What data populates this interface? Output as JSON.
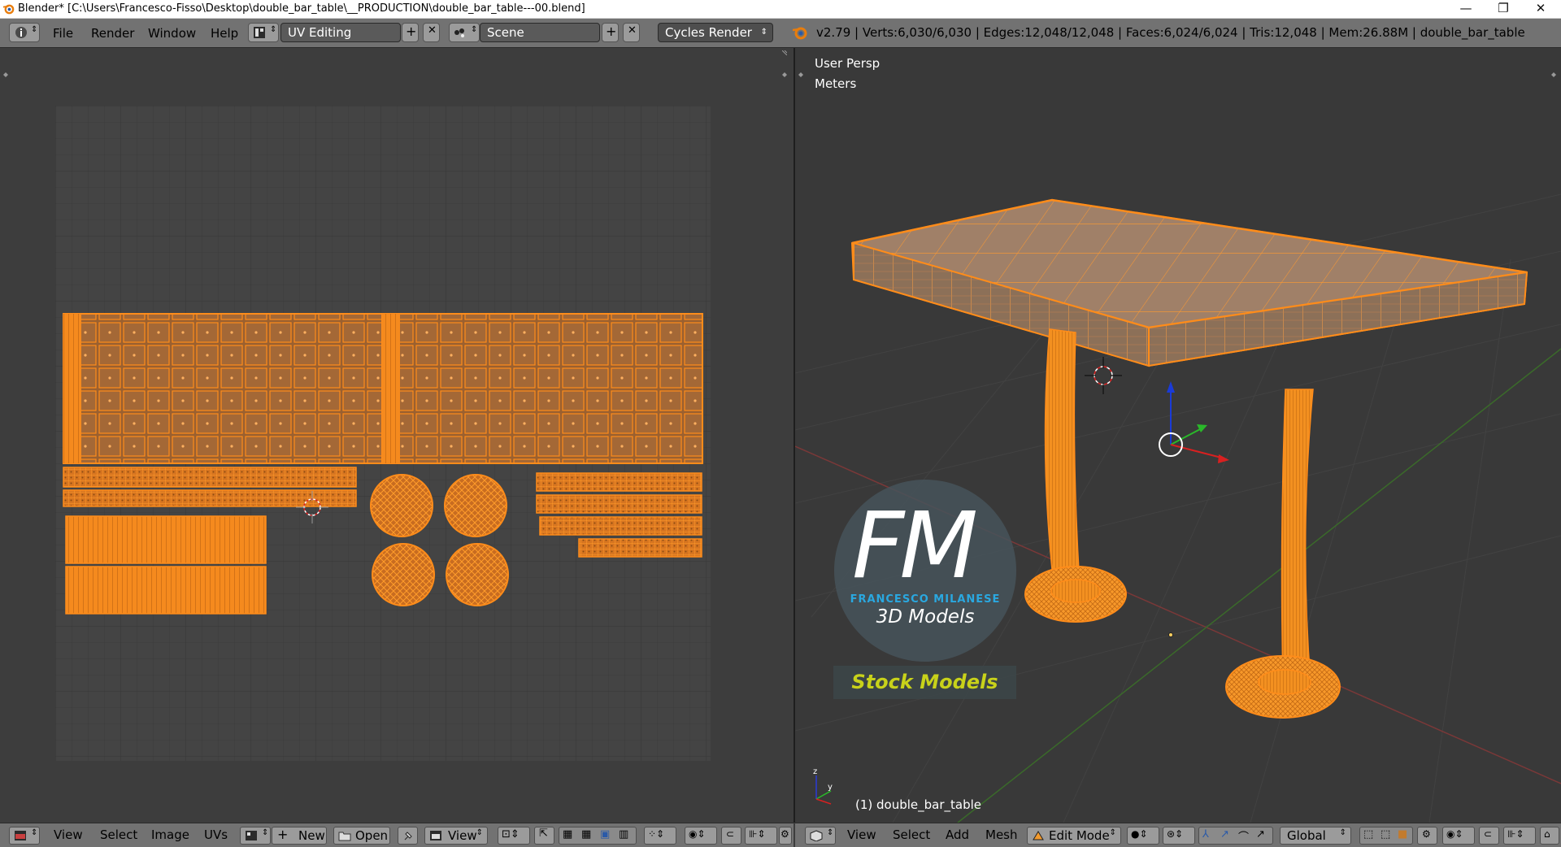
{
  "window": {
    "title": "Blender* [C:\\Users\\Francesco-Fisso\\Desktop\\double_bar_table\\__PRODUCTION\\double_bar_table---00.blend]",
    "controls": [
      "—",
      "❐",
      "✕"
    ]
  },
  "topbar": {
    "menus": [
      "File",
      "Render",
      "Window",
      "Help"
    ],
    "screen_layout": "UV Editing",
    "scene": "Scene",
    "render_engine": "Cycles Render",
    "stats": "v2.79 | Verts:6,030/6,030 | Edges:12,048/12,048 | Faces:6,024/6,024 | Tris:12,048 | Mem:26.88M | double_bar_table"
  },
  "viewport": {
    "view_name": "User Persp",
    "units": "Meters",
    "object_label": "(1) double_bar_table"
  },
  "watermark": {
    "logo_text": "FM",
    "brand": "FRANCESCO MILANESE",
    "subtitle": "3D Models",
    "banner": "Stock Models"
  },
  "uv_footer": {
    "menus": [
      "View",
      "Select",
      "Image",
      "UVs"
    ],
    "new_label": "New",
    "open_label": "Open",
    "view_label": "View"
  },
  "view3d_footer": {
    "menus": [
      "View",
      "Select",
      "Add",
      "Mesh"
    ],
    "mode": "Edit Mode",
    "orientation": "Global"
  },
  "colors": {
    "accent": "#ff8c1a",
    "panel": "#727272",
    "background": "#3d3d3d"
  }
}
